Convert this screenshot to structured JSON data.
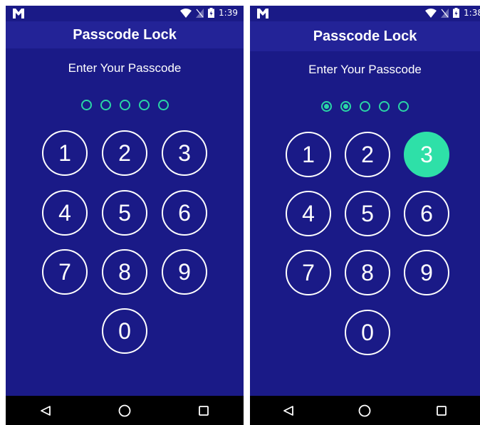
{
  "colors": {
    "background": "#1a1a87",
    "appbar": "#232397",
    "accent": "#2ad6a6",
    "pressed": "#2ee0a8"
  },
  "screens": [
    {
      "status": {
        "time": "1:39"
      },
      "app_title": "Passcode Lock",
      "prompt": "Enter Your Passcode",
      "entered_digits": 0,
      "keys": [
        "1",
        "2",
        "3",
        "4",
        "5",
        "6",
        "7",
        "8",
        "9",
        "0"
      ]
    },
    {
      "status": {
        "time": "1:38"
      },
      "app_title": "Passcode Lock",
      "prompt": "Enter Your Passcode",
      "entered_digits": 2,
      "pressed_key": "3",
      "keys": [
        "1",
        "2",
        "3",
        "4",
        "5",
        "6",
        "7",
        "8",
        "9",
        "0"
      ]
    }
  ],
  "icons": {
    "status_logo": "m-logo-icon",
    "wifi": "wifi-icon",
    "no_signal": "no-signal-icon",
    "battery": "battery-charging-icon",
    "nav_back": "back-triangle-icon",
    "nav_home": "home-circle-icon",
    "nav_recent": "recent-square-icon"
  }
}
